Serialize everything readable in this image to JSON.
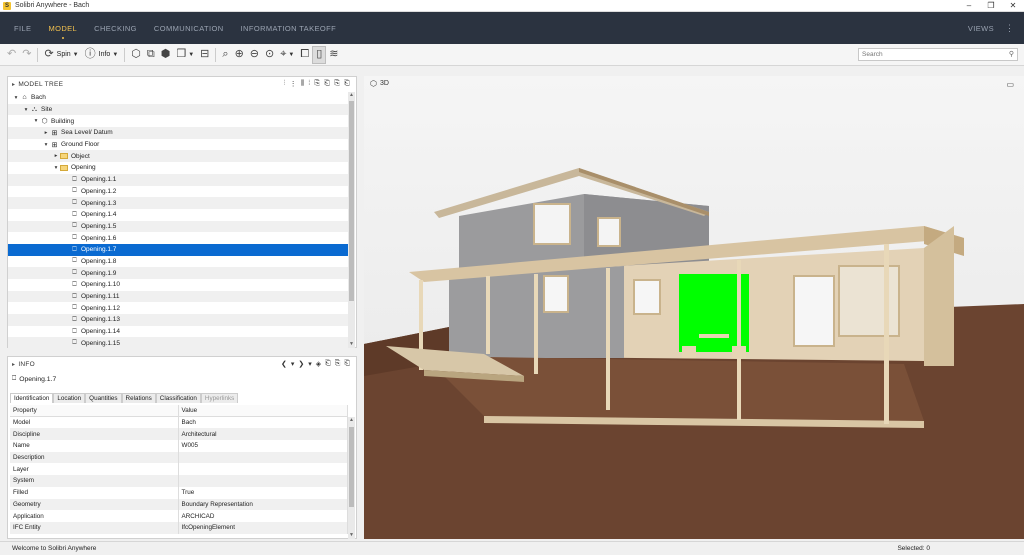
{
  "window": {
    "title": "Solibri Anywhere - Bach",
    "app_icon": "S",
    "minimize": "–",
    "restore": "❐",
    "close": "✕"
  },
  "menu": {
    "items": [
      "FILE",
      "MODEL",
      "CHECKING",
      "COMMUNICATION",
      "INFORMATION TAKEOFF"
    ],
    "active": "MODEL",
    "views": "VIEWS",
    "more": "⋮"
  },
  "toolbar": {
    "spin_label": "Spin",
    "info_label": "Info",
    "search_placeholder": "Search"
  },
  "model_tree": {
    "title": "MODEL TREE",
    "rows": [
      {
        "label": "Bach",
        "indent": 0,
        "twisty": "▾",
        "kind": "model"
      },
      {
        "label": "Site",
        "indent": 1,
        "twisty": "▾",
        "kind": "site"
      },
      {
        "label": "Building",
        "indent": 2,
        "twisty": "▾",
        "kind": "building"
      },
      {
        "label": "Sea Level/ Datum",
        "indent": 3,
        "twisty": "▸",
        "kind": "storey"
      },
      {
        "label": "Ground Floor",
        "indent": 3,
        "twisty": "▾",
        "kind": "storey"
      },
      {
        "label": "Object",
        "indent": 4,
        "twisty": "▸",
        "kind": "folder"
      },
      {
        "label": "Opening",
        "indent": 4,
        "twisty": "▾",
        "kind": "folder"
      },
      {
        "label": "Opening.1.1",
        "indent": 5,
        "twisty": "",
        "kind": "opening"
      },
      {
        "label": "Opening.1.2",
        "indent": 5,
        "twisty": "",
        "kind": "opening"
      },
      {
        "label": "Opening.1.3",
        "indent": 5,
        "twisty": "",
        "kind": "opening"
      },
      {
        "label": "Opening.1.4",
        "indent": 5,
        "twisty": "",
        "kind": "opening"
      },
      {
        "label": "Opening.1.5",
        "indent": 5,
        "twisty": "",
        "kind": "opening"
      },
      {
        "label": "Opening.1.6",
        "indent": 5,
        "twisty": "",
        "kind": "opening"
      },
      {
        "label": "Opening.1.7",
        "indent": 5,
        "twisty": "",
        "kind": "opening",
        "selected": true
      },
      {
        "label": "Opening.1.8",
        "indent": 5,
        "twisty": "",
        "kind": "opening"
      },
      {
        "label": "Opening.1.9",
        "indent": 5,
        "twisty": "",
        "kind": "opening"
      },
      {
        "label": "Opening.1.10",
        "indent": 5,
        "twisty": "",
        "kind": "opening"
      },
      {
        "label": "Opening.1.11",
        "indent": 5,
        "twisty": "",
        "kind": "opening"
      },
      {
        "label": "Opening.1.12",
        "indent": 5,
        "twisty": "",
        "kind": "opening"
      },
      {
        "label": "Opening.1.13",
        "indent": 5,
        "twisty": "",
        "kind": "opening"
      },
      {
        "label": "Opening.1.14",
        "indent": 5,
        "twisty": "",
        "kind": "opening"
      },
      {
        "label": "Opening.1.15",
        "indent": 5,
        "twisty": "",
        "kind": "opening"
      }
    ]
  },
  "info": {
    "title": "INFO",
    "selected_name": "Opening.1.7",
    "tabs": [
      "Identification",
      "Location",
      "Quantities",
      "Relations",
      "Classification",
      "Hyperlinks"
    ],
    "active_tab": "Identification",
    "disabled_tab": "Hyperlinks",
    "columns": [
      "Property",
      "Value"
    ],
    "rows": [
      [
        "Model",
        "Bach"
      ],
      [
        "Discipline",
        "Architectural"
      ],
      [
        "Name",
        "W005"
      ],
      [
        "Description",
        ""
      ],
      [
        "Layer",
        ""
      ],
      [
        "System",
        ""
      ],
      [
        "Filled",
        "True"
      ],
      [
        "Geometry",
        "Boundary Representation"
      ],
      [
        "Application",
        "ARCHICAD"
      ],
      [
        "IFC Entity",
        "IfcOpeningElement"
      ]
    ]
  },
  "viewport": {
    "label": "3D",
    "highlight_color": "#00ff00"
  },
  "status": {
    "message": "Welcome to Solibri Anywhere",
    "selected": "Selected: 0"
  }
}
